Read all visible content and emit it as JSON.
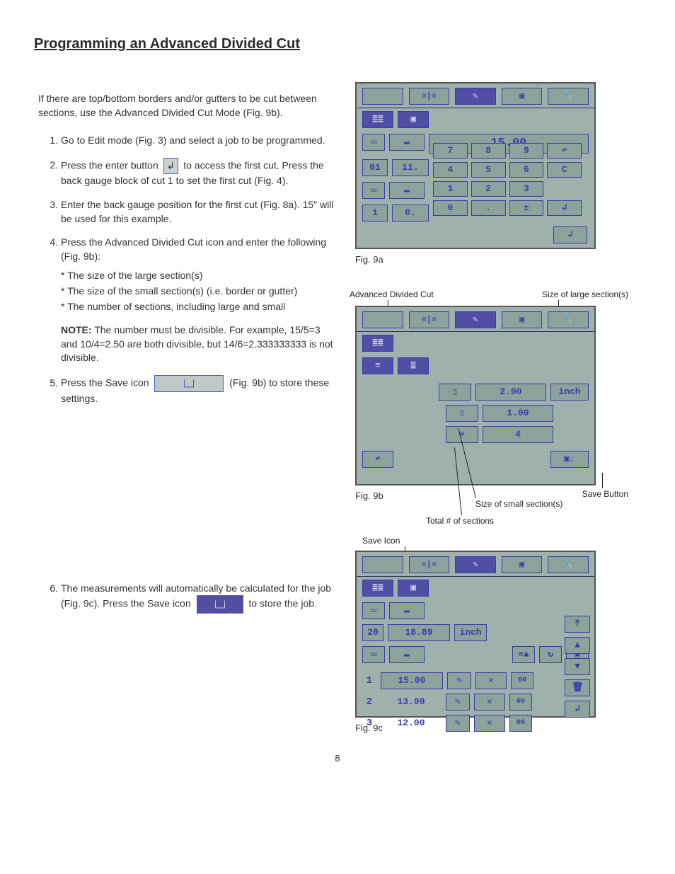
{
  "title": "Programming an Advanced Divided Cut",
  "intro": "If there are top/bottom borders and/or gutters to be cut between sections, use the Advanced Divided Cut Mode (Fig. 9b).",
  "steps": {
    "s1": "Go to Edit mode (Fig. 3) and select a job to be programmed.",
    "s2a": "Press the enter button",
    "s2b": "to access the first cut. Press the back gauge block of cut 1 to set the first cut (Fig. 4).",
    "s3": "Enter the back gauge position for the first cut (Fig. 8a). 15\" will be used for this example.",
    "s4": "Press the Advanced Divided Cut icon and enter the following (Fig. 9b):",
    "s4_b1": "* The size of the large section(s)",
    "s4_b2": "* The size of the small section(s) (i.e. border or gutter)",
    "s4_b3": "* The number of sections, including large and small",
    "s4_note_lead": "NOTE:",
    "s4_note": " The number must be divisible. For example, 15/5=3 and 10/4=2.50 are both divisible, but 14/6=2.333333333 is not divisible.",
    "s5a": "Press the Save icon",
    "s5b": "(Fig. 9b) to store these settings.",
    "s6a": "The measurements will automatically be calculated for the job (Fig. 9c).  Press the Save icon",
    "s6b": "to store the job."
  },
  "fig9a": {
    "caption": "Fig. 9a",
    "display": "15.00",
    "job": "01",
    "jobval": "11.",
    "cut": "1",
    "cutval": "0.",
    "keys": [
      "7",
      "8",
      "9",
      "↶",
      "4",
      "5",
      "6",
      "C",
      "1",
      "2",
      "3",
      "",
      "0",
      ".",
      "±",
      "↲"
    ]
  },
  "fig9b": {
    "caption": "Fig. 9b",
    "label_adc": "Advanced Divided Cut",
    "label_large": "Size of large section(s)",
    "label_small": "Size of small section(s)",
    "label_total": "Total # of sections",
    "label_save": "Save Button",
    "large": "2.00",
    "small": "1.00",
    "count": "4",
    "unit": "inch"
  },
  "fig9c": {
    "caption": "Fig. 9c",
    "label_saveicon": "Save Icon",
    "header_n": "20",
    "header_v": "18.89",
    "header_u": "inch",
    "rows": [
      {
        "n": "1",
        "v": "15.00",
        "t": "00"
      },
      {
        "n": "2",
        "v": "13.00",
        "t": "00"
      },
      {
        "n": "3",
        "v": "12.00",
        "t": "00"
      }
    ]
  },
  "icons": {
    "enter": "↲"
  },
  "page_number": "8"
}
